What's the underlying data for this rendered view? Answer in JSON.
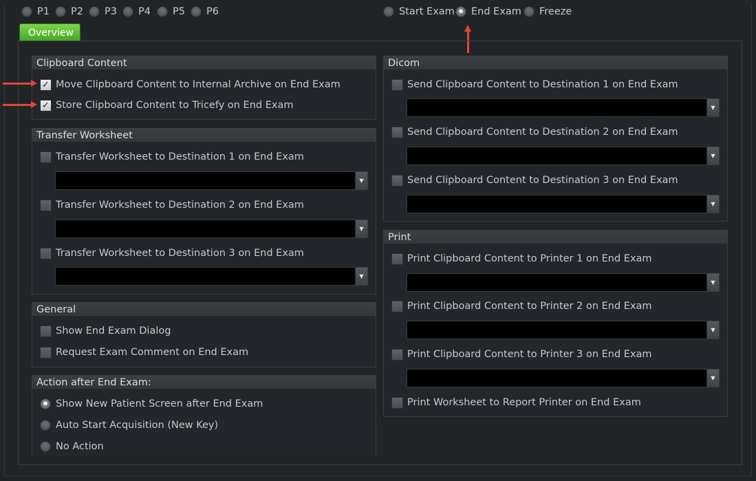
{
  "presets": [
    "P1",
    "P2",
    "P3",
    "P4",
    "P5",
    "P6"
  ],
  "trigger_options": {
    "start_exam": "Start Exam",
    "end_exam": "End Exam",
    "freeze": "Freeze",
    "selected": "End Exam"
  },
  "tab": {
    "label": "Overview"
  },
  "clipboard_content": {
    "title": "Clipboard Content",
    "items": [
      {
        "label": "Move Clipboard Content to Internal Archive on End Exam",
        "checked": true
      },
      {
        "label": "Store Clipboard Content to Tricefy on End Exam",
        "checked": true
      }
    ]
  },
  "transfer_worksheet": {
    "title": "Transfer Worksheet",
    "items": [
      {
        "label": "Transfer Worksheet to Destination 1 on End Exam",
        "checked": false,
        "value": ""
      },
      {
        "label": "Transfer Worksheet to Destination 2 on End Exam",
        "checked": false,
        "value": ""
      },
      {
        "label": "Transfer Worksheet to Destination 3 on End Exam",
        "checked": false,
        "value": ""
      }
    ]
  },
  "general": {
    "title": "General",
    "items": [
      {
        "label": "Show End Exam Dialog",
        "checked": false
      },
      {
        "label": "Request Exam Comment on End Exam",
        "checked": false
      }
    ]
  },
  "action_after": {
    "title": "Action after End Exam:",
    "options": [
      {
        "label": "Show New Patient Screen after End Exam",
        "selected": true
      },
      {
        "label": "Auto Start Acquisition (New Key)",
        "selected": false
      },
      {
        "label": "No Action",
        "selected": false
      }
    ]
  },
  "dicom": {
    "title": "Dicom",
    "items": [
      {
        "label": "Send Clipboard Content to Destination 1 on End Exam",
        "checked": false,
        "value": ""
      },
      {
        "label": "Send Clipboard Content to Destination 2 on End Exam",
        "checked": false,
        "value": ""
      },
      {
        "label": "Send Clipboard Content to Destination 3 on End Exam",
        "checked": false,
        "value": ""
      }
    ]
  },
  "print": {
    "title": "Print",
    "items": [
      {
        "label": "Print Clipboard Content to Printer 1 on End Exam",
        "checked": false,
        "value": ""
      },
      {
        "label": "Print Clipboard Content to Printer 2 on End Exam",
        "checked": false,
        "value": ""
      },
      {
        "label": "Print Clipboard Content to Printer 3 on End Exam",
        "checked": false,
        "value": ""
      }
    ],
    "report": {
      "label": "Print Worksheet to Report Printer on End Exam",
      "checked": false
    }
  },
  "colors": {
    "annotation_arrow": "#e0463a",
    "tab_green": "#5cbf34"
  }
}
